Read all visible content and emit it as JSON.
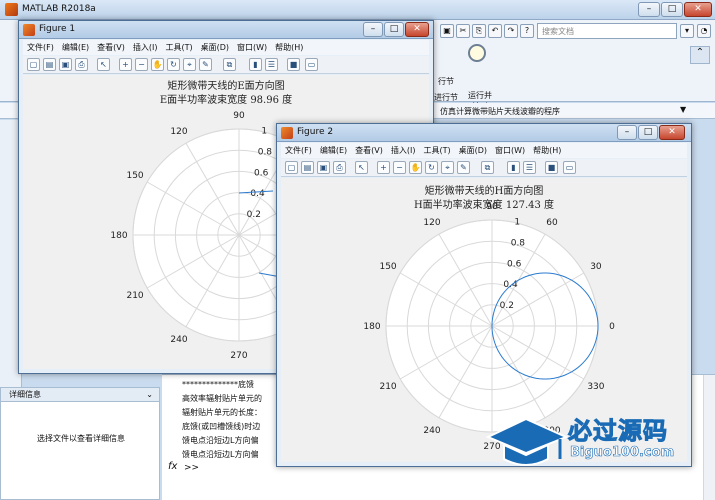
{
  "matlab": {
    "title": "MATLAB R2018a",
    "search_placeholder": "搜索文档",
    "ribbon": {
      "run_section": "行节",
      "run_and_time": "运行并\n计时",
      "run_and_time_l1": "运行并",
      "run_and_time_l2": "计时",
      "sec_left": "进行节"
    },
    "path_text": "仿真计算微带贴片天线波瓣的程序",
    "details": {
      "header": "详细信息",
      "message": "选择文件以查看详细信息"
    },
    "command_lines": [
      "**************底馈",
      "高效率辐射贴片单元的",
      "辐射贴片单元的长度：",
      "底馈(或凹槽馈线)时边",
      "馈电点沿短边L方向偏",
      "馈电点沿短边L方向偏"
    ],
    "prompt_fx": "fx",
    "prompt": ">>"
  },
  "figure1": {
    "title": "Figure 1",
    "menu": [
      "文件(F)",
      "编辑(E)",
      "查看(V)",
      "插入(I)",
      "工具(T)",
      "桌面(D)",
      "窗口(W)",
      "帮助(H)"
    ],
    "plot_title": "矩形微带天线的E面方向图",
    "plot_subtitle": "E面半功率波束宽度 98.96 度",
    "angle_labels": [
      "90",
      "120",
      "150",
      "180",
      "210",
      "240",
      "270"
    ],
    "radial_labels": [
      "1",
      "0.8",
      "0.6",
      "0.4",
      "0.2"
    ]
  },
  "figure2": {
    "title": "Figure 2",
    "menu": [
      "文件(F)",
      "编辑(E)",
      "查看(V)",
      "插入(I)",
      "工具(T)",
      "桌面(D)",
      "窗口(W)",
      "帮助(H)"
    ],
    "plot_title": "矩形微带天线的H面方向图",
    "plot_subtitle": "H面半功率波束宽度 127.43 度",
    "angle_labels": [
      "90",
      "60",
      "30",
      "0",
      "330",
      "300",
      "270",
      "240",
      "210",
      "180",
      "150",
      "120"
    ],
    "radial_labels": [
      "1",
      "0.8",
      "0.6",
      "0.4",
      "0.2"
    ]
  },
  "watermark": {
    "text": "必过源码",
    "url": "Biguo100.com"
  },
  "colors": {
    "plot_line": "#2b7bd0",
    "grid": "#d9d9d9",
    "accent": "#1a6bb5"
  }
}
